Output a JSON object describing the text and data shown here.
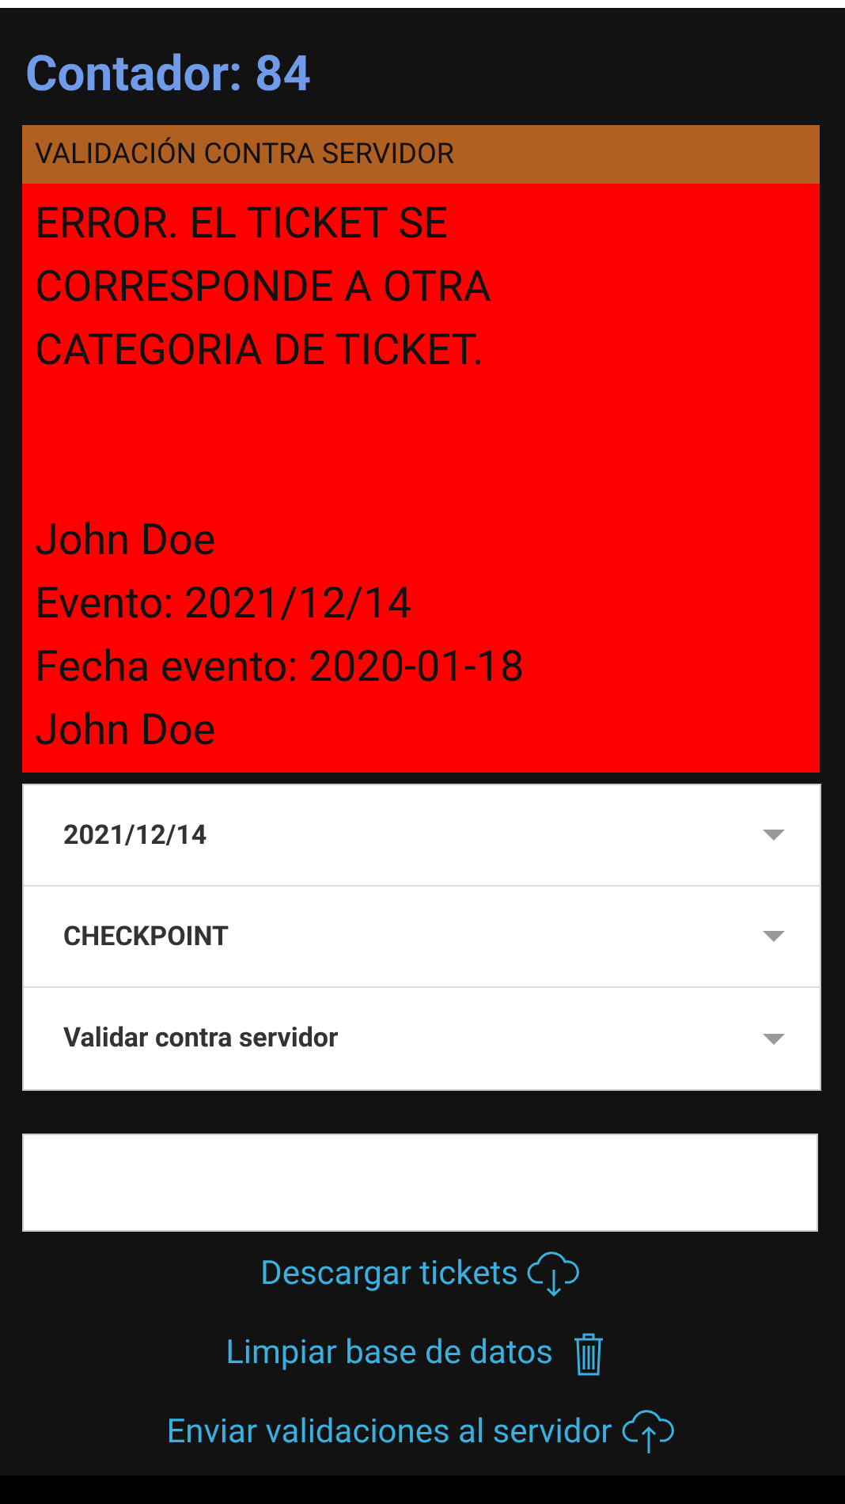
{
  "counter": {
    "title": "Contador: 84"
  },
  "result": {
    "header": "VALIDACIÓN CONTRA SERVIDOR",
    "message_lines": [
      "ERROR. EL TICKET SE",
      "CORRESPONDE A OTRA",
      "CATEGORIA DE TICKET."
    ],
    "detail_lines": [
      "John Doe",
      "Evento: 2021/12/14",
      "Fecha evento: 2020-01-18",
      "John Doe"
    ]
  },
  "selects": [
    {
      "value": "2021/12/14"
    },
    {
      "value": "CHECKPOINT"
    },
    {
      "value": "Validar contra servidor"
    }
  ],
  "actions": [
    {
      "label": "Descargar tickets",
      "kind": "download"
    },
    {
      "label": "Limpiar base de datos",
      "kind": "trash"
    },
    {
      "label": "Enviar validaciones al servidor",
      "kind": "upload"
    }
  ]
}
